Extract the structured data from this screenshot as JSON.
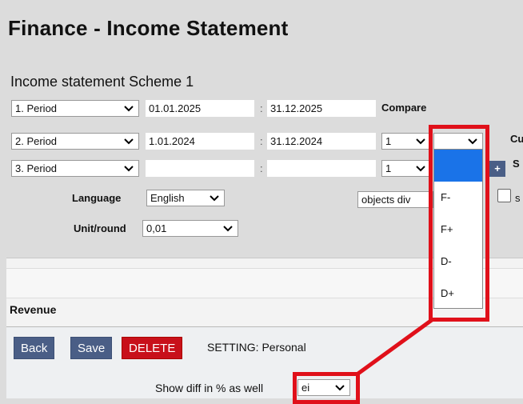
{
  "page": {
    "title": "Finance - Income Statement",
    "scheme": "Income statement Scheme 1"
  },
  "periods": [
    {
      "label": "1. Period",
      "from": "01.01.2025",
      "to": "31.12.2025"
    },
    {
      "label": "2. Period",
      "from": "1.01.2024",
      "to": "31.12.2024",
      "compare_value": "1"
    },
    {
      "label": "3. Period",
      "from": "",
      "to": "",
      "compare_value": "1"
    }
  ],
  "compare": {
    "label": "Compare"
  },
  "colon": ":",
  "language": {
    "label": "Language",
    "value": "English"
  },
  "unit": {
    "label": "Unit/round",
    "value": "0,01"
  },
  "objects_select": "objects div",
  "dropdown": {
    "options": [
      "",
      "F-",
      "F+",
      "D-",
      "D+"
    ]
  },
  "right_edge": {
    "cu": "Cu",
    "s1": "S",
    "s2": "s"
  },
  "plus_button": "+",
  "report": {
    "revenue": "Revenue"
  },
  "toolbar": {
    "back": "Back",
    "save": "Save",
    "delete": "DELETE",
    "setting": "SETTING: Personal"
  },
  "show_diff": {
    "label": "Show diff in % as well",
    "value": "ei"
  },
  "colors": {
    "highlight_red": "#e0101a",
    "selected_blue": "#1a73e8",
    "button_blue": "#4a5e86",
    "delete_red": "#c8101a"
  }
}
